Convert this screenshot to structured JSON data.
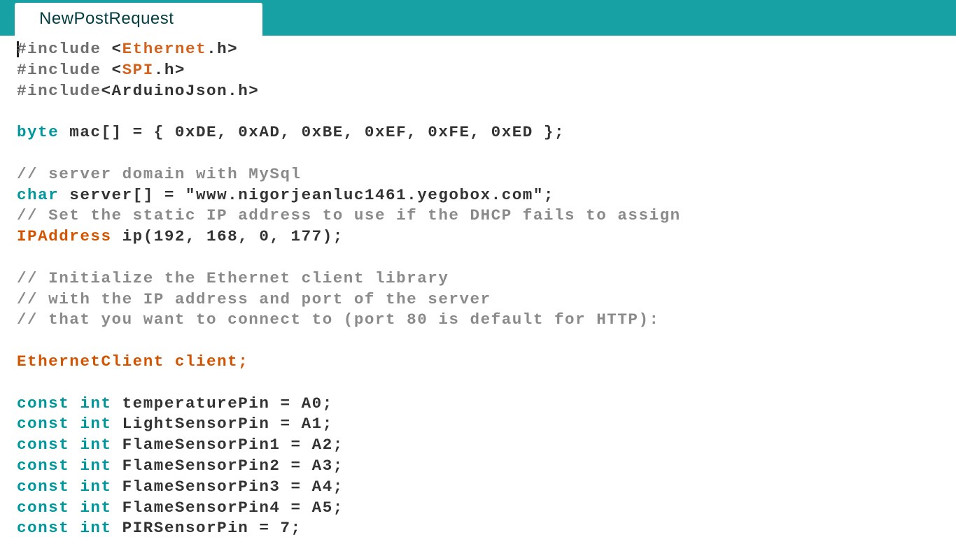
{
  "tab": {
    "label": "NewPostRequest"
  },
  "colors": {
    "tabbar": "#17a1a5",
    "keyword": "#00979c",
    "library": "#d2631e",
    "comment": "#8a8a8a",
    "text": "#333333"
  },
  "code": [
    [
      {
        "t": "#include ",
        "c": "pp"
      },
      {
        "t": "<",
        "c": "tx"
      },
      {
        "t": "Ethernet",
        "c": "lib"
      },
      {
        "t": ".h>",
        "c": "tx"
      }
    ],
    [
      {
        "t": "#include ",
        "c": "pp"
      },
      {
        "t": "<",
        "c": "tx"
      },
      {
        "t": "SPI",
        "c": "lib"
      },
      {
        "t": ".h>",
        "c": "tx"
      }
    ],
    [
      {
        "t": "#include",
        "c": "pp"
      },
      {
        "t": "<ArduinoJson.h>",
        "c": "tx"
      }
    ],
    [],
    [
      {
        "t": "byte",
        "c": "kw"
      },
      {
        "t": " mac[] = { 0xDE, 0xAD, 0xBE, 0xEF, 0xFE, 0xED };",
        "c": "tx"
      }
    ],
    [],
    [
      {
        "t": "// server domain with MySql",
        "c": "cm"
      }
    ],
    [
      {
        "t": "char",
        "c": "kw"
      },
      {
        "t": " server[] = \"www.nigorjeanluc1461.yegobox.com\";",
        "c": "tx"
      }
    ],
    [
      {
        "t": "// Set the static IP address to use if the DHCP fails to assign",
        "c": "cm"
      }
    ],
    [
      {
        "t": "IPAddress",
        "c": "kw2"
      },
      {
        "t": " ip(192, 168, 0, 177);",
        "c": "tx"
      }
    ],
    [],
    [
      {
        "t": "// Initialize the Ethernet client library",
        "c": "cm"
      }
    ],
    [
      {
        "t": "// with the IP address and port of the server",
        "c": "cm"
      }
    ],
    [
      {
        "t": "// that you want to connect to (port 80 is default for HTTP):",
        "c": "cm"
      }
    ],
    [],
    [
      {
        "t": "EthernetClient",
        "c": "kw2"
      },
      {
        "t": " client;",
        "c": "kw2"
      }
    ],
    [],
    [
      {
        "t": "const",
        "c": "kw"
      },
      {
        "t": " ",
        "c": "tx"
      },
      {
        "t": "int",
        "c": "kw"
      },
      {
        "t": " temperaturePin = A0;",
        "c": "tx"
      }
    ],
    [
      {
        "t": "const",
        "c": "kw"
      },
      {
        "t": " ",
        "c": "tx"
      },
      {
        "t": "int",
        "c": "kw"
      },
      {
        "t": " LightSensorPin = A1;",
        "c": "tx"
      }
    ],
    [
      {
        "t": "const",
        "c": "kw"
      },
      {
        "t": " ",
        "c": "tx"
      },
      {
        "t": "int",
        "c": "kw"
      },
      {
        "t": " FlameSensorPin1 = A2;",
        "c": "tx"
      }
    ],
    [
      {
        "t": "const",
        "c": "kw"
      },
      {
        "t": " ",
        "c": "tx"
      },
      {
        "t": "int",
        "c": "kw"
      },
      {
        "t": " FlameSensorPin2 = A3;",
        "c": "tx"
      }
    ],
    [
      {
        "t": "const",
        "c": "kw"
      },
      {
        "t": " ",
        "c": "tx"
      },
      {
        "t": "int",
        "c": "kw"
      },
      {
        "t": " FlameSensorPin3 = A4;",
        "c": "tx"
      }
    ],
    [
      {
        "t": "const",
        "c": "kw"
      },
      {
        "t": " ",
        "c": "tx"
      },
      {
        "t": "int",
        "c": "kw"
      },
      {
        "t": " FlameSensorPin4 = A5;",
        "c": "tx"
      }
    ],
    [
      {
        "t": "const",
        "c": "kw"
      },
      {
        "t": " ",
        "c": "tx"
      },
      {
        "t": "int",
        "c": "kw"
      },
      {
        "t": " PIRSensorPin = 7;",
        "c": "tx"
      }
    ]
  ]
}
